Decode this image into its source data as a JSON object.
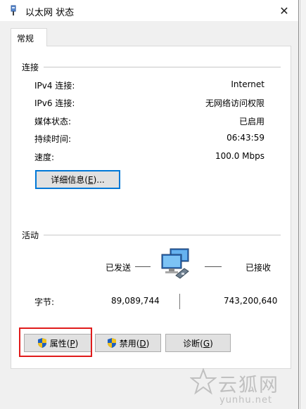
{
  "window": {
    "title": "以太网 状态",
    "close_glyph": "✕"
  },
  "tabs": [
    {
      "label": "常规"
    }
  ],
  "connection": {
    "title": "连接",
    "rows": [
      {
        "label": "IPv4 连接:",
        "value": "Internet"
      },
      {
        "label": "IPv6 连接:",
        "value": "无网络访问权限"
      },
      {
        "label": "媒体状态:",
        "value": "已启用"
      },
      {
        "label": "持续时间:",
        "value": "06:43:59"
      },
      {
        "label": "速度:",
        "value": "100.0 Mbps"
      }
    ],
    "details_button": {
      "text": "详细信息(",
      "key": "E",
      "suffix": ")..."
    }
  },
  "activity": {
    "title": "活动",
    "sent_label": "已发送",
    "received_label": "已接收",
    "bytes_label": "字节:",
    "bytes_sent": "89,089,744",
    "bytes_received": "743,200,640"
  },
  "buttons": {
    "properties": {
      "text": "属性(",
      "key": "P",
      "suffix": ")"
    },
    "disable": {
      "text": "禁用(",
      "key": "D",
      "suffix": ")"
    },
    "diagnose": {
      "text": "诊断(",
      "key": "G",
      "suffix": ")"
    }
  },
  "watermark": {
    "cn": "云狐网",
    "en": "yunhu.net"
  },
  "colors": {
    "highlight": "#e01b1b",
    "focus": "#0078d7",
    "shield_blue": "#1f5fbf",
    "shield_yellow": "#f2c21b"
  },
  "icons": {
    "network": "network-computers-icon",
    "shield": "uac-shield-icon",
    "close": "close-icon"
  }
}
